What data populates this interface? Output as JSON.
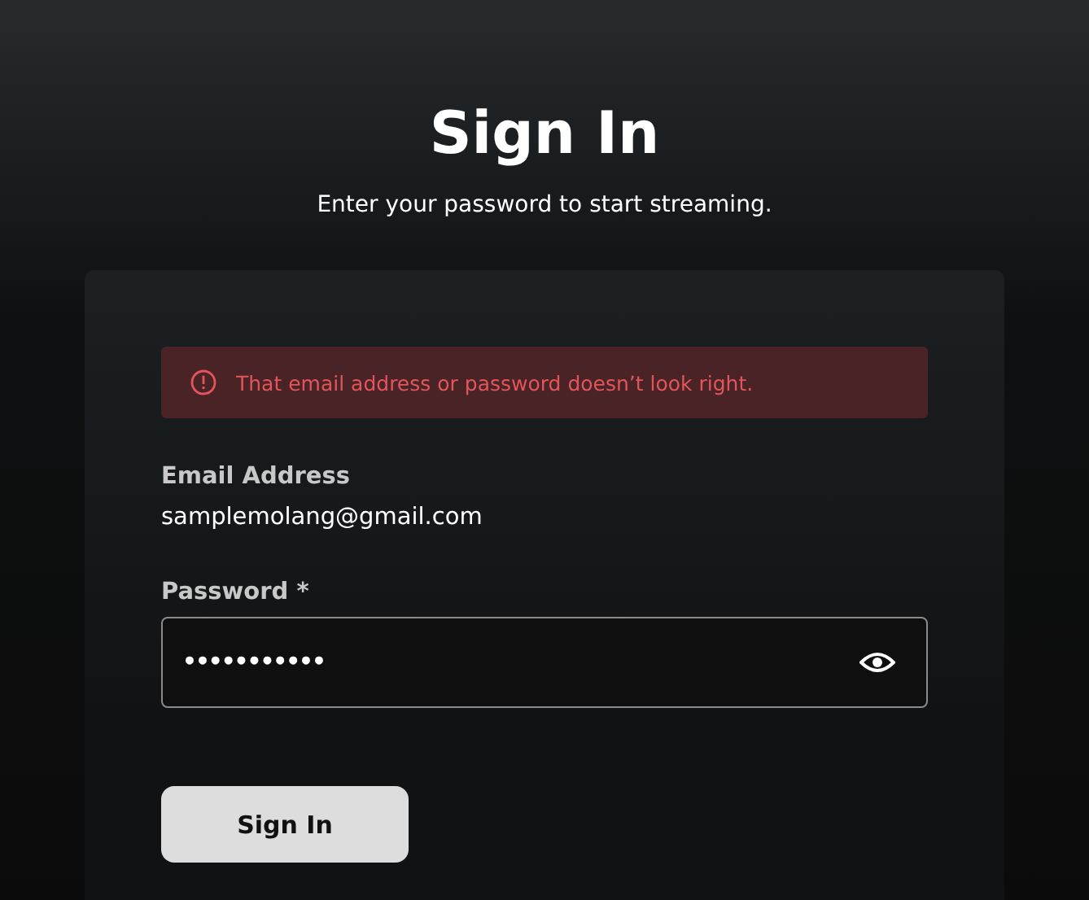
{
  "title": "Sign In",
  "subtitle": "Enter your password to start streaming.",
  "alert": {
    "message": "That email address or password doesn’t look right."
  },
  "email": {
    "label": "Email Address",
    "value": "samplemolang@gmail.com"
  },
  "password": {
    "label": "Password *",
    "value": "•••••••••••"
  },
  "button": "Sign In"
}
